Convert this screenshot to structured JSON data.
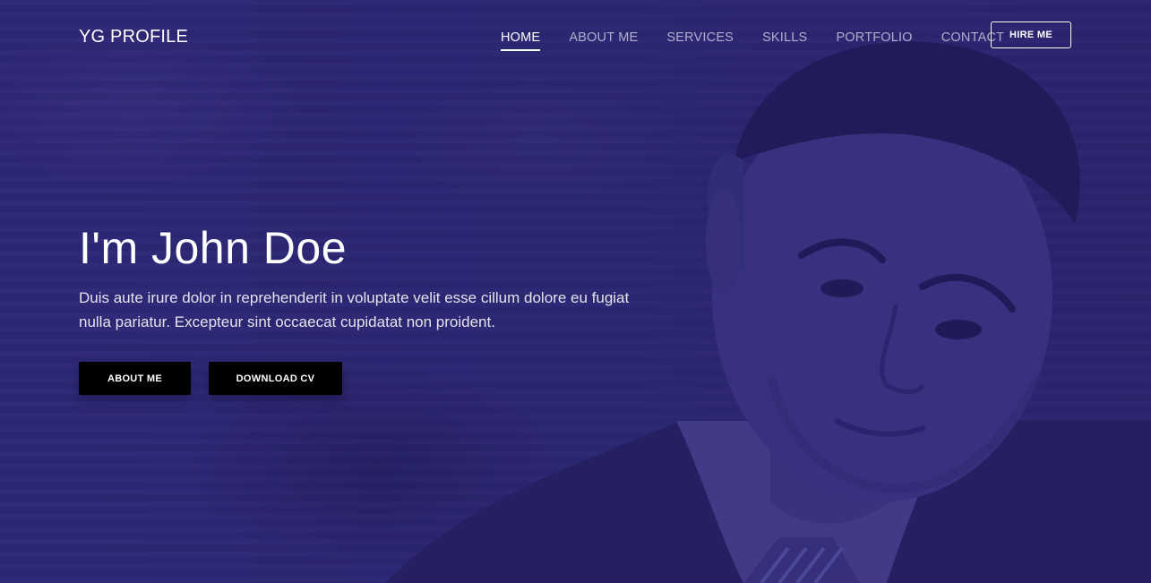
{
  "brand": {
    "name": "YG PROFILE"
  },
  "nav": {
    "items": [
      {
        "label": "HOME",
        "active": true
      },
      {
        "label": "ABOUT ME",
        "active": false
      },
      {
        "label": "SERVICES",
        "active": false
      },
      {
        "label": "SKILLS",
        "active": false
      },
      {
        "label": "PORTFOLIO",
        "active": false
      },
      {
        "label": "CONTACT",
        "active": false
      }
    ],
    "cta_label": "HIRE ME"
  },
  "hero": {
    "headline": "I'm John Doe",
    "subtitle": "Duis aute irure dolor in reprehenderit in voluptate velit esse cillum dolore eu fugiat nulla pariatur. Excepteur sint occaecat cupidatat non proident.",
    "primary_button": "ABOUT ME",
    "secondary_button": "DOWNLOAD CV"
  },
  "colors": {
    "overlay": "#2d2770",
    "button_bg": "#000000",
    "text": "#ffffff"
  }
}
